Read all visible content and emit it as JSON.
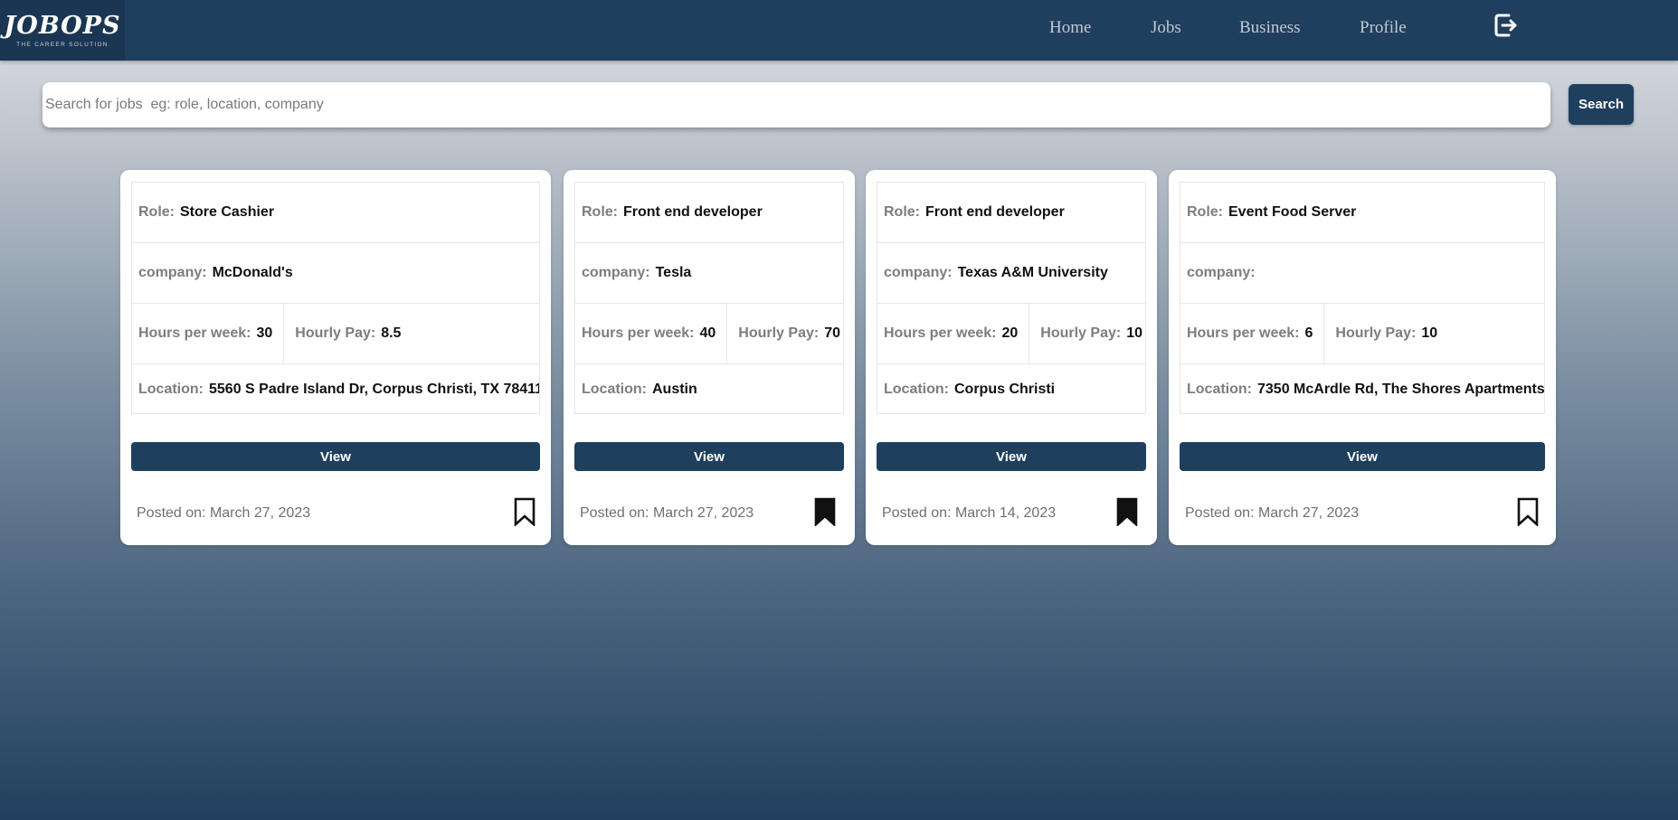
{
  "app": {
    "logo_text": "JOBOPS",
    "logo_tagline": "THE CAREER SOLUTION"
  },
  "nav": {
    "items": [
      {
        "label": "Home"
      },
      {
        "label": "Jobs"
      },
      {
        "label": "Business"
      },
      {
        "label": "Profile"
      }
    ],
    "logout_icon": "logout-icon"
  },
  "search": {
    "placeholder": "Search for jobs  eg: role, location, company",
    "value": "",
    "button_label": "Search"
  },
  "labels": {
    "role": "Role:",
    "company": "company:",
    "hours": "Hours per week:",
    "pay": "Hourly Pay:",
    "location": "Location:",
    "view": "View"
  },
  "jobs": [
    {
      "role": "Store Cashier",
      "company": "McDonald's",
      "hours": "30",
      "pay": "8.5",
      "location": "5560 S Padre Island Dr, Corpus Christi, TX 78411",
      "posted": "Posted on: March 27, 2023",
      "bookmarked": false
    },
    {
      "role": "Front end developer",
      "company": "Tesla",
      "hours": "40",
      "pay": "70",
      "location": "Austin",
      "posted": "Posted on: March 27, 2023",
      "bookmarked": true
    },
    {
      "role": "Front end developer",
      "company": "Texas A&M University",
      "hours": "20",
      "pay": "10",
      "location": "Corpus Christi",
      "posted": "Posted on: March 14, 2023",
      "bookmarked": true
    },
    {
      "role": "Event Food Server",
      "company": "",
      "hours": "6",
      "pay": "10",
      "location": "7350 McArdle Rd, The Shores Apartments",
      "posted": "Posted on: March 27, 2023",
      "bookmarked": false
    }
  ],
  "colors": {
    "navbar": "#1f3f5e",
    "primary_button": "#1f3f5e",
    "label_gray": "#7d7d7d"
  }
}
